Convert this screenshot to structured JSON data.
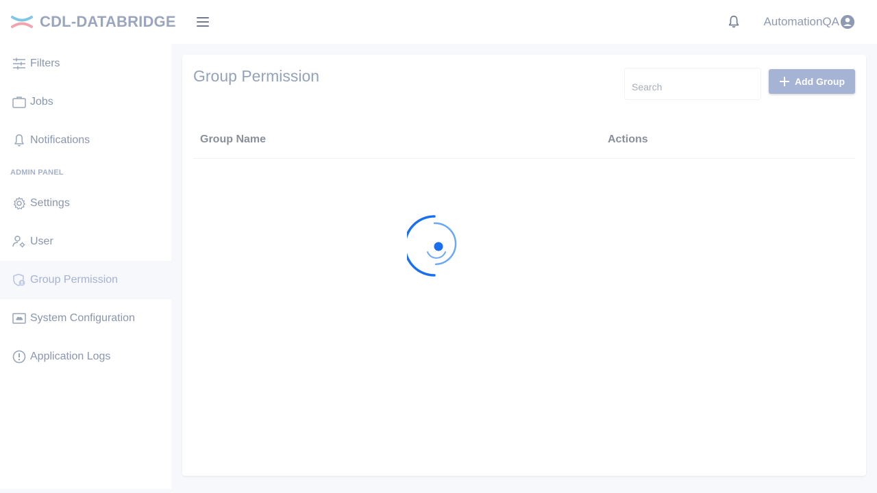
{
  "app": {
    "name": "CDL-DATABRIDGE",
    "user": "AutomationQA"
  },
  "sidebar": {
    "items": [
      {
        "label": "Filters",
        "icon": "filters-icon"
      },
      {
        "label": "Jobs",
        "icon": "briefcase-icon"
      },
      {
        "label": "Notifications",
        "icon": "bell-icon"
      }
    ],
    "admin_section_label": "ADMIN PANEL",
    "admin_items": [
      {
        "label": "Settings",
        "icon": "gear-icon"
      },
      {
        "label": "User",
        "icon": "user-gear-icon"
      },
      {
        "label": "Group Permission",
        "icon": "shield-group-icon",
        "active": true
      },
      {
        "label": "System Configuration",
        "icon": "monitor-cloud-icon"
      },
      {
        "label": "Application Logs",
        "icon": "alert-circle-icon"
      }
    ]
  },
  "main": {
    "title": "Group Permission",
    "search": {
      "placeholder": "Search",
      "value": ""
    },
    "add_button_label": "Add Group",
    "table": {
      "columns": [
        "Group Name",
        "Actions"
      ],
      "rows": []
    },
    "loading": true
  },
  "colors": {
    "accent": "#a5b4d4",
    "spinner": "#1a6ff0",
    "logo_top": "#7ec8e3",
    "logo_bottom": "#f4a3ad"
  }
}
